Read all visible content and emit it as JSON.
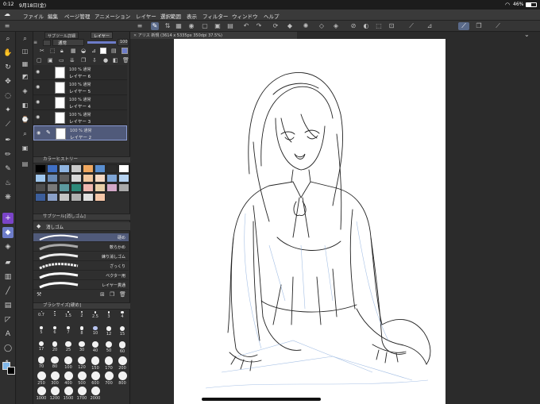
{
  "status_bar": {
    "time": "0:12",
    "date": "9月18日(金)",
    "battery": "46%"
  },
  "menu": {
    "items": [
      "ファイル",
      "編集",
      "ページ管理",
      "アニメーション",
      "レイヤー",
      "選択範囲",
      "表示",
      "フィルター",
      "ウィンドウ",
      "ヘルプ"
    ]
  },
  "colors": {
    "accent": "#6d7cc9",
    "selected_layer": "#505a7a",
    "panel_bg": "#2f2f2f",
    "canvas_bg": "#2b2b2b",
    "paper": "#ffffff"
  },
  "layers_panel": {
    "tabs": [
      "サブツール詳細",
      "レイヤー"
    ],
    "blend_mode": "通常",
    "opacity": "100",
    "layers": [
      {
        "opacity_mode": "100 % 通常",
        "name": "レイヤー 6"
      },
      {
        "opacity_mode": "100 % 通常",
        "name": "レイヤー 5"
      },
      {
        "opacity_mode": "100 % 通常",
        "name": "レイヤー 4"
      },
      {
        "opacity_mode": "100 % 通常",
        "name": "レイヤー 3"
      },
      {
        "opacity_mode": "100 % 通常",
        "name": "レイヤー 2"
      }
    ]
  },
  "color_history": {
    "title": "カラーヒストリー",
    "swatches": [
      "#000000",
      "#3f6fc4",
      "#8fb4e0",
      "#c9c9c9",
      "#f0a860",
      "#5a8fd0",
      "#2b2b2b",
      "#ffffff",
      "#9fc7ee",
      "#6b8bb5",
      "#5e5e5e",
      "#d8d8d8",
      "#f2c8a0",
      "#f6d9c4",
      "#7ea5d6",
      "#b5d2f0",
      "#4d4d4d",
      "#7a7a7a",
      "#5c9aa0",
      "#2e8a7a",
      "#f0b8b0",
      "#e8cfa8",
      "#d3a8c8",
      "#a9a9a9",
      "#3c5e9b",
      "#8aa0c8",
      "#c4c4c4",
      "#b0b0b0",
      "#e0e0e0",
      "#f7c7a8"
    ]
  },
  "subtool": {
    "title": "サブツール[消しゴム]",
    "group": "消しゴム",
    "brushes": [
      "硬め",
      "軟らかめ",
      "練り消しゴム",
      "ざっくり",
      "ベクター用",
      "レイヤー貫通"
    ]
  },
  "brush_size": {
    "title": "ブラシサイズ[硬め]",
    "sizes": [
      "0.7",
      "1",
      "1.5",
      "2",
      "2.5",
      "3",
      "4",
      "5",
      "6",
      "7",
      "8",
      "10",
      "12",
      "15",
      "17",
      "20",
      "25",
      "30",
      "40",
      "50",
      "60",
      "70",
      "80",
      "100",
      "120",
      "150",
      "170",
      "200",
      "250",
      "300",
      "400",
      "500",
      "600",
      "700",
      "800",
      "1000",
      "1200",
      "1500",
      "1700",
      "2000"
    ]
  },
  "document": {
    "tab_label": "アリス 新規 (3614 x 5335px 350dpi 37.5%)"
  }
}
